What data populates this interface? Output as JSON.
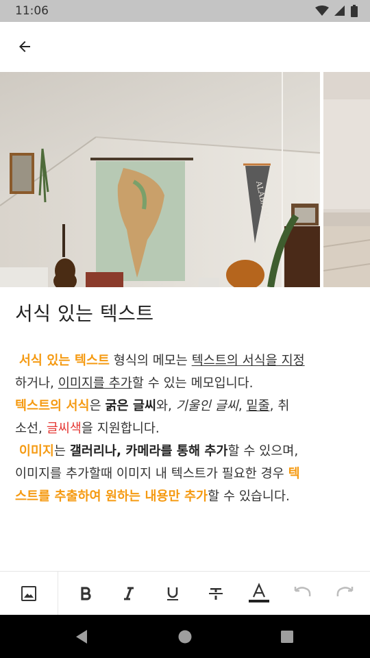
{
  "status_bar": {
    "time": "11:06"
  },
  "note": {
    "title": "서식 있는 텍스트",
    "body": {
      "l1a": "서식 있는 텍스트",
      "l1b": " 형식의 메모는 ",
      "l1c": "텍스트의 서식을 지정",
      "l2a": "하거나, ",
      "l2b": "이미지를 추가",
      "l2c": "할 수 있는 메모입니다.",
      "l3a": "텍스트의 서식",
      "l3b": "은  ",
      "l3c": "굵은 글씨",
      "l3d": "와,  ",
      "l3e": "기울인 글씨",
      "l3f": ", ",
      "l3g": "밑줄",
      "l3h": ", 취",
      "l4a": "소선, ",
      "l4b": "글씨색",
      "l4c": "을 지원합니다.",
      "l5a": "이미지",
      "l5b": "는 ",
      "l5c": "갤러리나, 카메라를 통해 추가",
      "l5d": "할 수 있으며,",
      "l6a": "이미지를 추가할때 이미지 내 텍스트가 필요한 경우 ",
      "l6b": "텍",
      "l7a": "스트를 추출하여 원하는 내용만 추가",
      "l7b": "할 수 있습니다."
    }
  },
  "gallery": {
    "pennant_text": "ALABAMA"
  },
  "toolbar": {
    "items": [
      "image-icon",
      "bold-icon",
      "italic-icon",
      "underline-icon",
      "strikethrough-icon",
      "text-color-icon",
      "undo-icon",
      "redo-icon"
    ]
  },
  "colors": {
    "accent_orange": "#f59a12",
    "accent_red": "#e53935",
    "status_bar": "#c4c4c4",
    "nav_bar": "#000000"
  }
}
